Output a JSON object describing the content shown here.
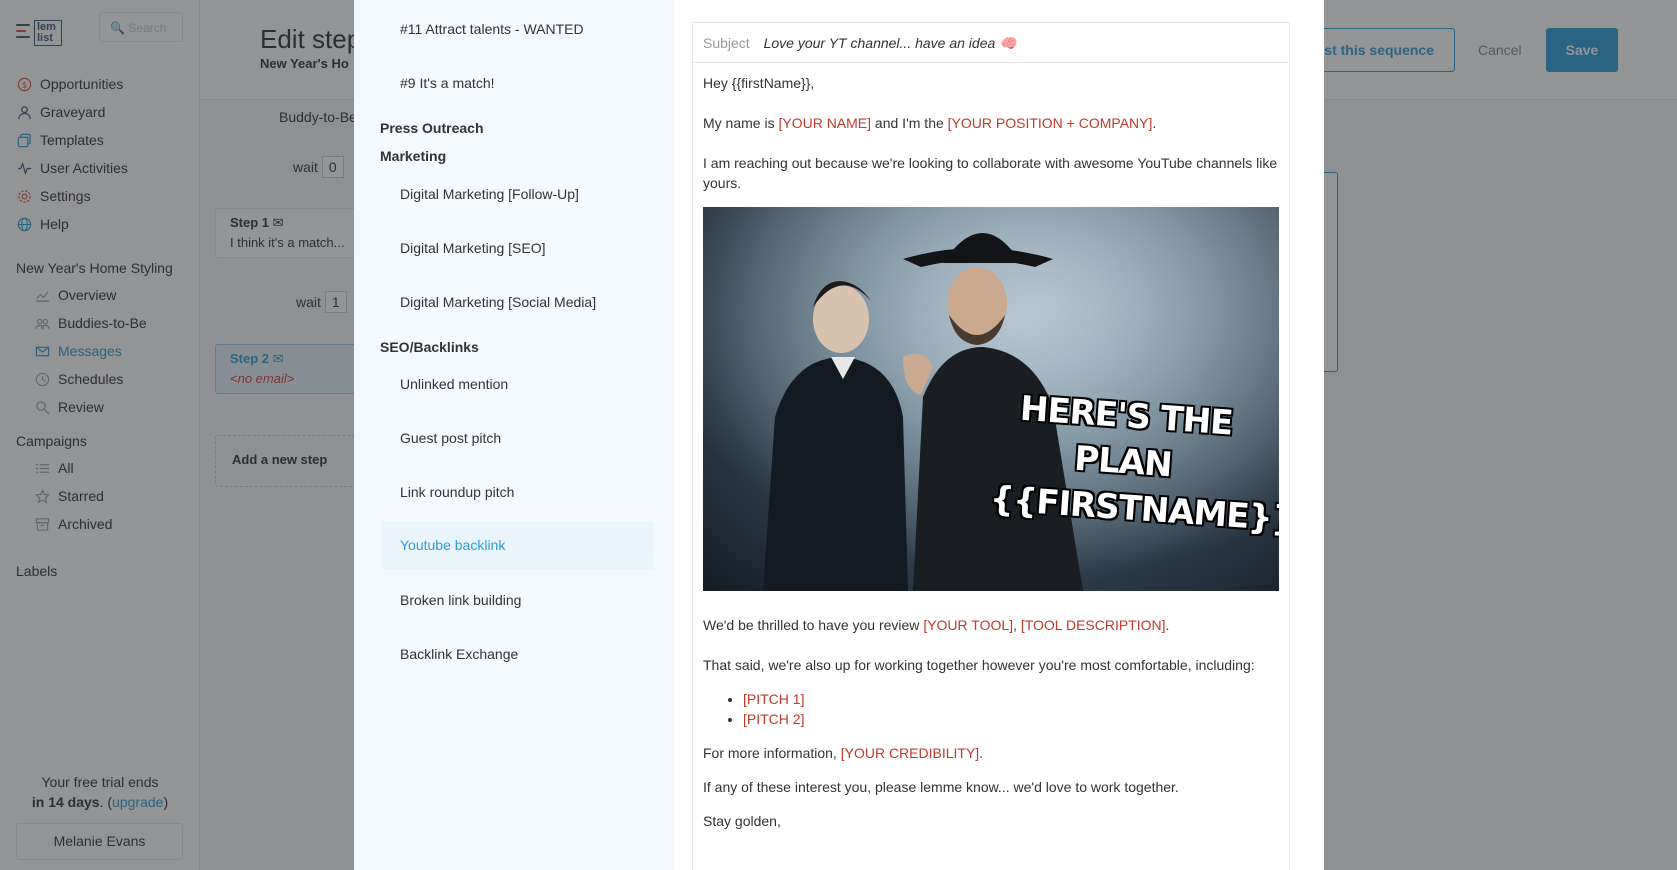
{
  "app": {
    "logo_text": "lem list",
    "search_placeholder": "Search"
  },
  "sidebar": {
    "nav": [
      {
        "label": "Opportunities",
        "icon": "dollar-icon"
      },
      {
        "label": "Graveyard",
        "icon": "person-icon"
      },
      {
        "label": "Templates",
        "icon": "templates-icon"
      },
      {
        "label": "User Activities",
        "icon": "activity-icon"
      },
      {
        "label": "Settings",
        "icon": "gear-icon"
      },
      {
        "label": "Help",
        "icon": "globe-icon"
      }
    ],
    "campaign_title": "New Year's Home Styling",
    "campaign_items": [
      {
        "label": "Overview",
        "icon": "chart-icon"
      },
      {
        "label": "Buddies-to-Be",
        "icon": "people-icon"
      },
      {
        "label": "Messages",
        "icon": "envelope-icon",
        "active": true
      },
      {
        "label": "Schedules",
        "icon": "clock-icon"
      },
      {
        "label": "Review",
        "icon": "magnifier-icon"
      }
    ],
    "campaigns_title": "Campaigns",
    "campaigns_items": [
      {
        "label": "All",
        "icon": "list-icon"
      },
      {
        "label": "Starred",
        "icon": "star-icon"
      },
      {
        "label": "Archived",
        "icon": "archive-icon"
      }
    ],
    "labels_title": "Labels",
    "trial_line1": "Your free trial ends",
    "trial_days": "in 14 days",
    "trial_upgrade": "upgrade",
    "user_name": "Melanie Evans"
  },
  "header": {
    "title": "Edit step",
    "subtitle": "New Year's Ho",
    "test_button": "est this sequence",
    "cancel_button": "Cancel",
    "save_button": "Save"
  },
  "steps": {
    "buddy_label": "Buddy-to-Be",
    "wait_label": "wait",
    "wait1_value": "0",
    "wait2_value": "1",
    "step1_title": "Step 1",
    "step1_body": "I think it's a match...",
    "step2_title": "Step 2",
    "step2_body": "<no email>",
    "add_step": "Add a new step"
  },
  "modal": {
    "templates": [
      {
        "label": "#11 Attract talents - WANTED"
      },
      {
        "label": "#9 It's a match!"
      },
      {
        "category": "Press Outreach"
      },
      {
        "category": "Marketing"
      },
      {
        "label": "Digital Marketing [Follow-Up]"
      },
      {
        "label": "Digital Marketing [SEO]"
      },
      {
        "label": "Digital Marketing [Social Media]"
      },
      {
        "category": "SEO/Backlinks"
      },
      {
        "label": "Unlinked mention"
      },
      {
        "label": "Guest post pitch"
      },
      {
        "label": "Link roundup pitch"
      },
      {
        "label": "Youtube backlink",
        "active": true
      },
      {
        "label": "Broken link building"
      },
      {
        "label": "Backlink Exchange"
      }
    ],
    "preview": {
      "subject_label": "Subject",
      "subject_value": "Love your YT channel... have an idea 🧠",
      "greeting": "Hey {{firstName}},",
      "intro_1": "My name is ",
      "ph_name": "[YOUR NAME]",
      "intro_2": " and I'm the ",
      "ph_position": "[YOUR POSITION + COMPANY]",
      "intro_3": ".",
      "reach_out": "I am reaching out because we're looking to collaborate with awesome YouTube channels like yours.",
      "meme_caption_1": "HERE'S THE PLAN",
      "meme_caption_2": "{{FIRSTNAME}}",
      "review_1": "We'd be thrilled to have you review ",
      "ph_tool": "[YOUR TOOL]",
      "review_sep": ", ",
      "ph_tool_desc": "[TOOL DESCRIPTION]",
      "review_end": ".",
      "said": "That said, we're also up for working together however you're most comfortable, including:",
      "pitch_1": "[PITCH 1]",
      "pitch_2": "[PITCH 2]",
      "info_1": "For more information, ",
      "ph_credibility": "[YOUR CREDIBILITY]",
      "info_end": ".",
      "interest": "If any of these interest you, please lemme know... we'd love to work together.",
      "signoff": "Stay golden,"
    }
  }
}
